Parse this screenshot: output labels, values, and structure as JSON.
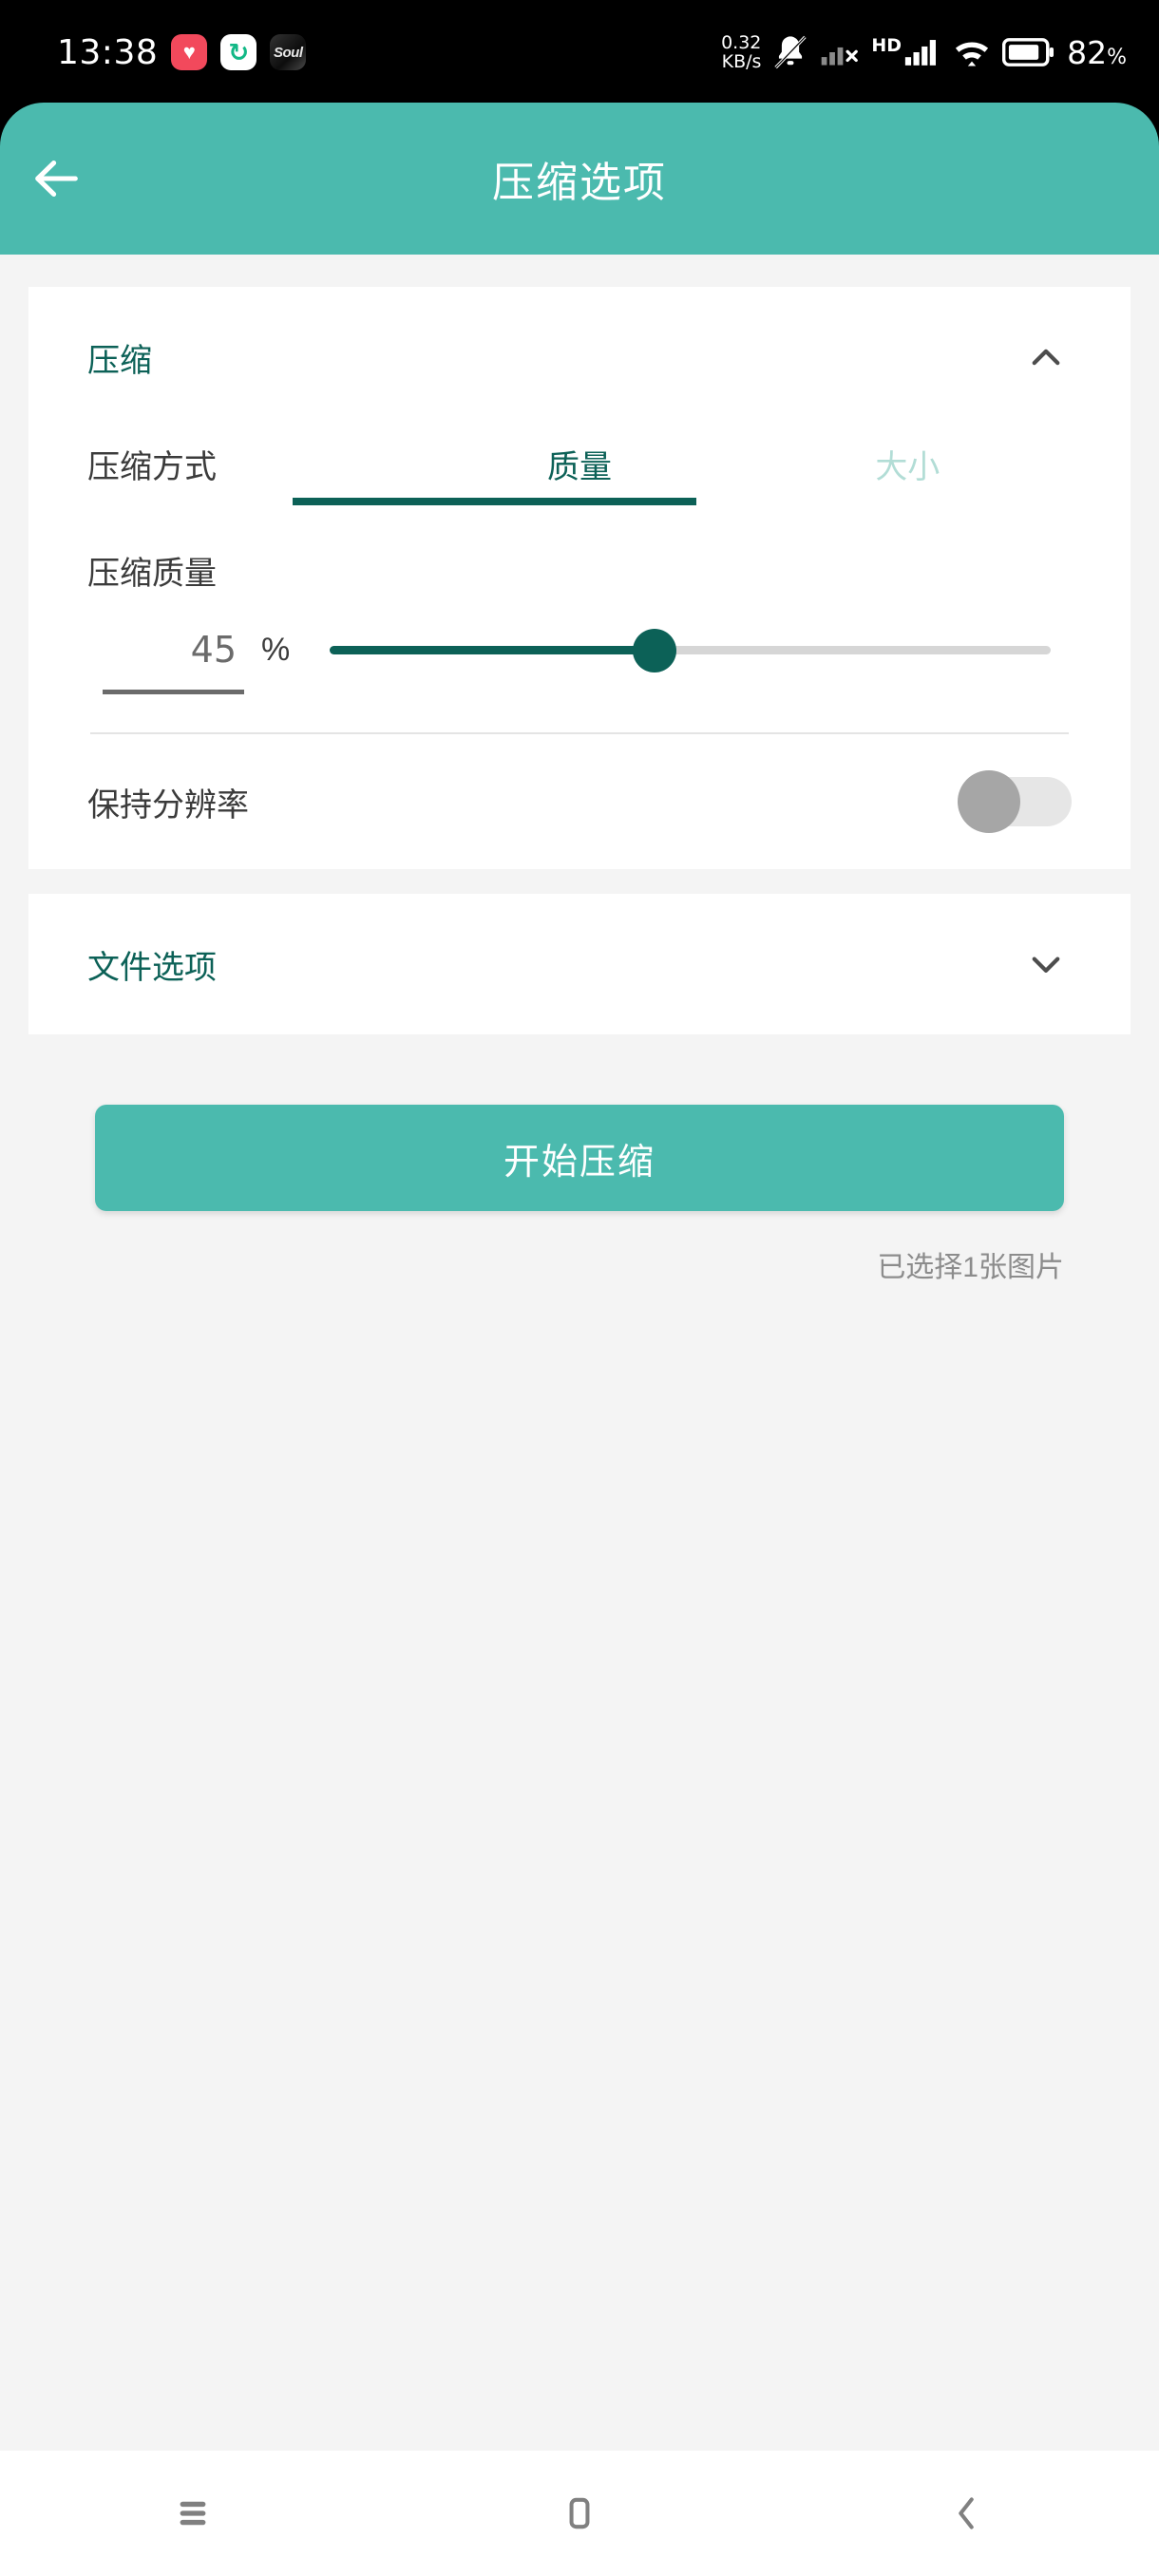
{
  "status_bar": {
    "time": "13:38",
    "app_icons": [
      {
        "name": "heart-app-icon",
        "glyph": "♥"
      },
      {
        "name": "recycle-app-icon",
        "glyph": "↻"
      },
      {
        "name": "soul-app-icon",
        "glyph": "Soul"
      }
    ],
    "net_speed_value": "0.32",
    "net_speed_unit": "KB/s",
    "icons": [
      "mute-icon",
      "signal-no-service-icon",
      "hd-icon",
      "signal-bars-icon",
      "wifi-icon",
      "battery-icon"
    ],
    "hd_label": "HD",
    "battery_percent": "82",
    "battery_unit": "%"
  },
  "appbar": {
    "back_icon": "back-arrow-icon",
    "title": "压缩选项",
    "background": "#4bbaae"
  },
  "compress_card": {
    "section_title": "压缩",
    "chevron": "chevron-up-icon",
    "method_label": "压缩方式",
    "tabs": [
      {
        "label": "质量",
        "active": true
      },
      {
        "label": "大小",
        "active": false
      }
    ],
    "quality_label": "压缩质量",
    "quality_value": "45",
    "quality_unit": "%",
    "slider_percent": 45,
    "keep_resolution_label": "保持分辨率",
    "keep_resolution_on": false
  },
  "file_card": {
    "section_title": "文件选项",
    "chevron": "chevron-down-icon"
  },
  "action": {
    "start_label": "开始压缩",
    "selected_note": "已选择1张图片"
  },
  "nav_bar": {
    "items": [
      {
        "name": "recents-icon"
      },
      {
        "name": "home-icon"
      },
      {
        "name": "back-icon"
      }
    ]
  },
  "colors": {
    "accent": "#4bbaae",
    "accent_dark": "#0c6157",
    "accent_light": "#b2ddd6",
    "page_bg": "#f4f4f4"
  }
}
